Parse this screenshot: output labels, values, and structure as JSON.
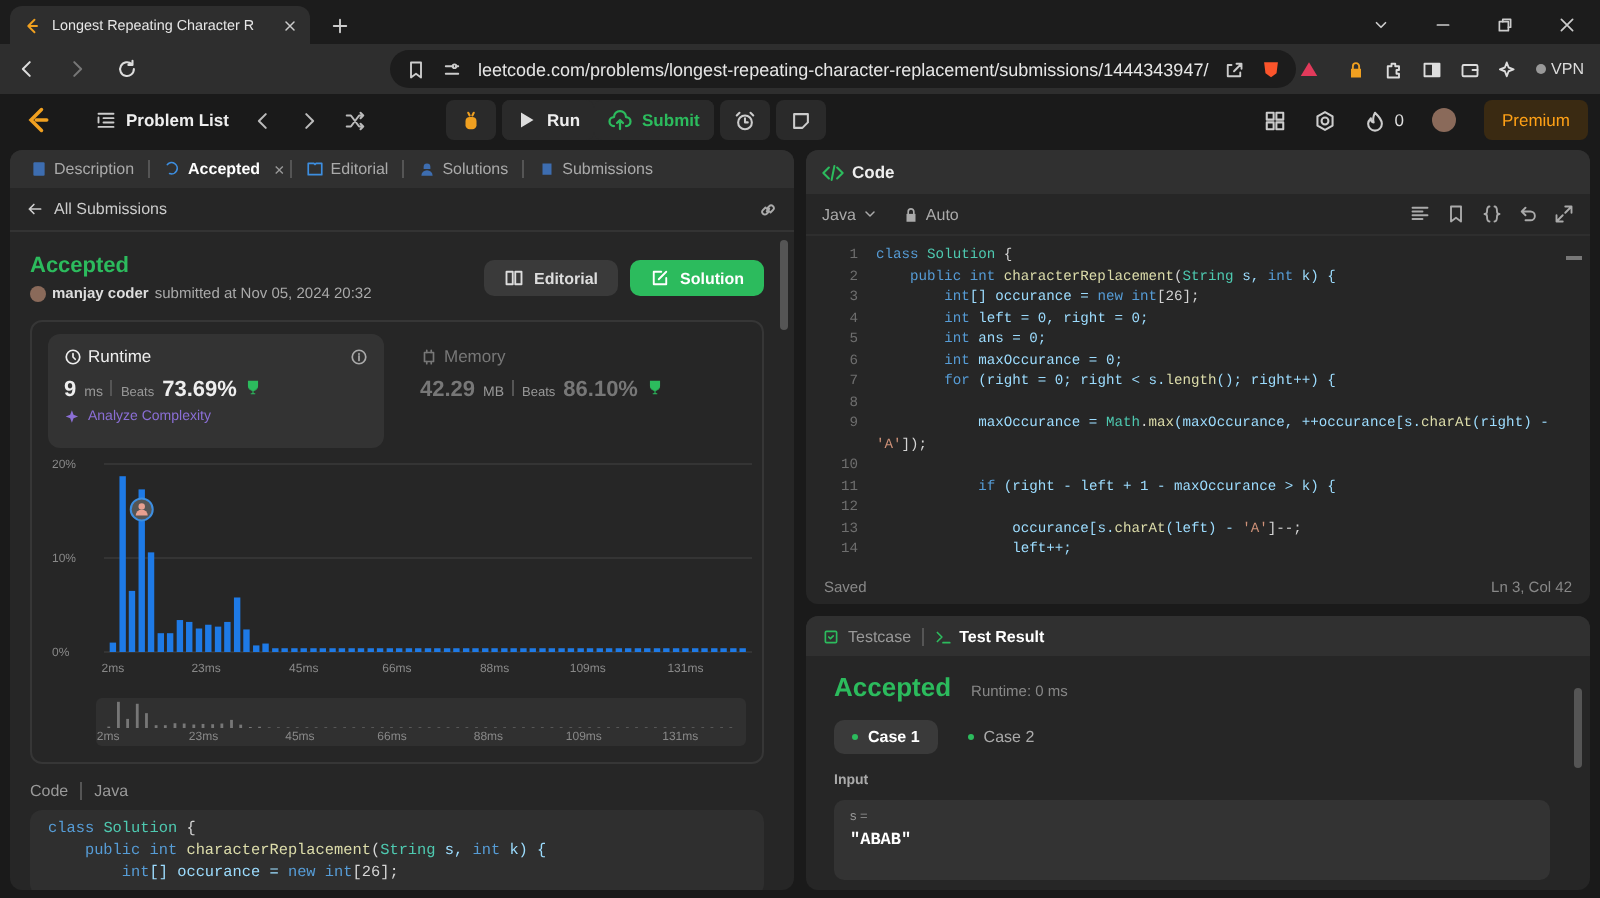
{
  "browser": {
    "tab_title": "Longest Repeating Character R",
    "url": "leetcode.com/problems/longest-repeating-character-replacement/submissions/1444343947/",
    "vpn_label": "VPN"
  },
  "header": {
    "problem_list": "Problem List",
    "run": "Run",
    "submit": "Submit",
    "streak": "0",
    "premium": "Premium"
  },
  "left_panel": {
    "tabs": [
      {
        "label": "Description",
        "selected": false
      },
      {
        "label": "Accepted",
        "selected": true,
        "close": "×"
      },
      {
        "label": "Editorial",
        "selected": false
      },
      {
        "label": "Solutions",
        "selected": false
      },
      {
        "label": "Submissions",
        "selected": false
      }
    ],
    "back_link": "All Submissions",
    "submission": {
      "status": "Accepted",
      "user": "manjay coder",
      "submitted_at": "submitted at Nov 05, 2024 20:32"
    },
    "buttons": [
      {
        "label": "Editorial",
        "kind": "secondary"
      },
      {
        "label": "Solution",
        "kind": "primary"
      }
    ],
    "stats": [
      {
        "kind": "runtime",
        "title": "Runtime",
        "value": "9",
        "unit": "ms",
        "beats_label": "Beats",
        "beats": "73.69%",
        "selected": true,
        "action": "Analyze Complexity"
      },
      {
        "kind": "memory",
        "title": "Memory",
        "value": "42.29",
        "unit": "MB",
        "beats_label": "Beats",
        "beats": "86.10%",
        "selected": false
      }
    ],
    "chart_data": {
      "type": "bar",
      "x": [
        2,
        4.2,
        6.3,
        8.5,
        10.6,
        12.8,
        14.9,
        17.1,
        19.2,
        21.4,
        23.5,
        25.7,
        27.8,
        30,
        32.1,
        34.3,
        36.4,
        38.6,
        40.7,
        42.9,
        45,
        47.2,
        49.3,
        51.5,
        53.6,
        55.8,
        57.9,
        60.1,
        62.2,
        64.4,
        66.5,
        68.7,
        70.8,
        73,
        75.1,
        77.3,
        79.4,
        81.6,
        83.7,
        85.9,
        88,
        90.2,
        92.3,
        94.5,
        96.6,
        98.8,
        100.9,
        103.1,
        105.2,
        107.4,
        109.5,
        111.7,
        113.8,
        116,
        118.1,
        120.3,
        122.4,
        124.6,
        126.7,
        128.9,
        131,
        133.2,
        135.3,
        137.5,
        139.6,
        141.8,
        143.9
      ],
      "values": [
        1,
        18.7,
        6.5,
        17.3,
        10.6,
        2,
        2,
        3.4,
        3.2,
        2.5,
        2.9,
        2.7,
        3.2,
        5.8,
        2.4,
        0.7,
        0.9,
        0.4,
        0.4,
        0.4,
        0.4,
        0.4,
        0.4,
        0.4,
        0.4,
        0.4,
        0.4,
        0.4,
        0.4,
        0.4,
        0.4,
        0.4,
        0.4,
        0.4,
        0.4,
        0.4,
        0.4,
        0.4,
        0.4,
        0.4,
        0.4,
        0.4,
        0.4,
        0.4,
        0.4,
        0.4,
        0.4,
        0.4,
        0.4,
        0.4,
        0.4,
        0.4,
        0.4,
        0.4,
        0.4,
        0.4,
        0.4,
        0.4,
        0.4,
        0.4,
        0.4,
        0.4,
        0.4,
        0.4,
        0.4,
        0.4,
        0.4
      ],
      "xlim": [
        0,
        146
      ],
      "xticks": [
        {
          "value": 2,
          "label": "2ms"
        },
        {
          "value": 23,
          "label": "23ms"
        },
        {
          "value": 45,
          "label": "45ms"
        },
        {
          "value": 66,
          "label": "66ms"
        },
        {
          "value": 88,
          "label": "88ms"
        },
        {
          "value": 109,
          "label": "109ms"
        },
        {
          "value": 131,
          "label": "131ms"
        }
      ],
      "yticks": [
        {
          "value": 0,
          "label": "0%"
        },
        {
          "value": 10,
          "label": "10%"
        },
        {
          "value": 20,
          "label": "20%"
        }
      ],
      "ylim": [
        0,
        20
      ]
    },
    "overview_labels": [
      "2ms",
      "23ms",
      "45ms",
      "66ms",
      "88ms",
      "109ms",
      "131ms"
    ],
    "code_section": {
      "title": "Code",
      "language": "Java",
      "lines": [
        {
          "tokens": [
            {
              "text": "class ",
              "kind": "kw"
            },
            {
              "text": "Solution",
              "kind": "type"
            },
            {
              "text": " {",
              "kind": "p"
            }
          ]
        },
        {
          "tokens": [
            {
              "text": "    public int ",
              "kind": "kw"
            },
            {
              "text": "characterReplacement",
              "kind": "fn"
            },
            {
              "text": "(",
              "kind": "p"
            },
            {
              "text": "String ",
              "kind": "type"
            },
            {
              "text": "s, ",
              "kind": "var"
            },
            {
              "text": "int ",
              "kind": "kw"
            },
            {
              "text": "k) {",
              "kind": "var"
            }
          ]
        },
        {
          "tokens": [
            {
              "text": "        int",
              "kind": "kw"
            },
            {
              "text": "[] occurance = ",
              "kind": "var"
            },
            {
              "text": "new int",
              "kind": "kw"
            },
            {
              "text": "[26];",
              "kind": "p"
            }
          ]
        }
      ]
    }
  },
  "code_panel": {
    "title": "Code",
    "language": "Java",
    "mode": "Auto",
    "lines": [
      {
        "no": "1",
        "tokens": [
          {
            "text": "class ",
            "kind": "kw"
          },
          {
            "text": "Solution",
            "kind": "type"
          },
          {
            "text": " {",
            "kind": "p"
          }
        ]
      },
      {
        "no": "2",
        "tokens": [
          {
            "text": "    public int ",
            "kind": "kw"
          },
          {
            "text": "characterReplacement",
            "kind": "fn"
          },
          {
            "text": "(",
            "kind": "p"
          },
          {
            "text": "String ",
            "kind": "type"
          },
          {
            "text": "s, ",
            "kind": "var"
          },
          {
            "text": "int ",
            "kind": "kw"
          },
          {
            "text": "k) {",
            "kind": "var"
          }
        ]
      },
      {
        "no": "3",
        "tokens": [
          {
            "text": "        int",
            "kind": "kw"
          },
          {
            "text": "[] occurance = ",
            "kind": "var"
          },
          {
            "text": "new int",
            "kind": "kw"
          },
          {
            "text": "[26];",
            "kind": "p"
          }
        ]
      },
      {
        "no": "4",
        "tokens": [
          {
            "text": "        int ",
            "kind": "kw"
          },
          {
            "text": "left = 0, right = 0;",
            "kind": "var"
          }
        ]
      },
      {
        "no": "5",
        "tokens": [
          {
            "text": "        int ",
            "kind": "kw"
          },
          {
            "text": "ans = 0;",
            "kind": "var"
          }
        ]
      },
      {
        "no": "6",
        "tokens": [
          {
            "text": "        int ",
            "kind": "kw"
          },
          {
            "text": "maxOccurance = 0;",
            "kind": "var"
          }
        ]
      },
      {
        "no": "7",
        "tokens": [
          {
            "text": "        for ",
            "kind": "kw"
          },
          {
            "text": "(right = 0; right < s.",
            "kind": "var"
          },
          {
            "text": "length",
            "kind": "fn"
          },
          {
            "text": "(); right++) {",
            "kind": "var"
          }
        ]
      },
      {
        "no": "8"
      },
      {
        "no": "9",
        "tokens": [
          {
            "text": "            maxOccurance = ",
            "kind": "var"
          },
          {
            "text": "Math",
            "kind": "type"
          },
          {
            "text": ".",
            "kind": "p"
          },
          {
            "text": "max",
            "kind": "fn"
          },
          {
            "text": "(maxOccurance, ++occurance[s.",
            "kind": "var"
          },
          {
            "text": "charAt",
            "kind": "fn"
          },
          {
            "text": "(right) - ",
            "kind": "var"
          },
          {
            "text": "'A'",
            "kind": "str"
          },
          {
            "text": "]);",
            "kind": "p"
          }
        ]
      },
      {
        "no": "10"
      },
      {
        "no": "11",
        "tokens": [
          {
            "text": "            if ",
            "kind": "kw"
          },
          {
            "text": "(right - left + 1 - maxOccurance > k) {",
            "kind": "var"
          }
        ]
      },
      {
        "no": "12"
      },
      {
        "no": "13",
        "tokens": [
          {
            "text": "                occurance[s.",
            "kind": "var"
          },
          {
            "text": "charAt",
            "kind": "fn"
          },
          {
            "text": "(left) - ",
            "kind": "var"
          },
          {
            "text": "'A'",
            "kind": "str"
          },
          {
            "text": "]--;",
            "kind": "p"
          }
        ]
      },
      {
        "no": "14",
        "tokens": [
          {
            "text": "                left++;",
            "kind": "var"
          }
        ]
      }
    ],
    "status": "Saved",
    "cursor": "Ln 3, Col 42"
  },
  "test_panel": {
    "tabs": [
      {
        "label": "Testcase",
        "selected": false
      },
      {
        "label": "Test Result",
        "selected": true
      }
    ],
    "status": "Accepted",
    "runtime": "Runtime: 0 ms",
    "cases": [
      {
        "label": "Case 1",
        "selected": true,
        "passed": true
      },
      {
        "label": "Case 2",
        "selected": false,
        "passed": true
      }
    ],
    "input_label": "Input",
    "param_name": "s =",
    "param_value": "\"ABAB\""
  }
}
